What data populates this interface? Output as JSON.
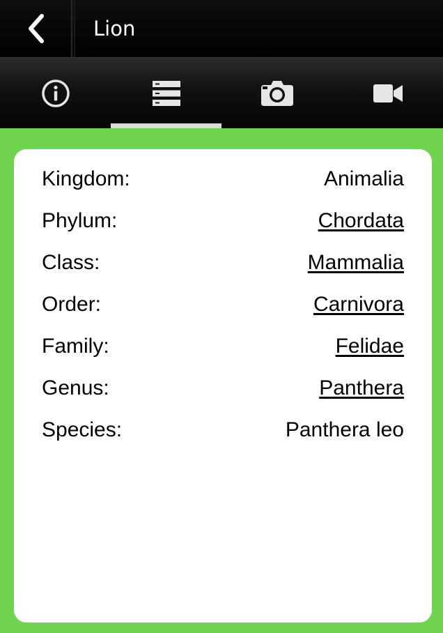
{
  "header": {
    "title": "Lion",
    "back_icon": "chevron-left-icon"
  },
  "tabs": [
    {
      "icon": "info-icon",
      "active": false
    },
    {
      "icon": "list-icon",
      "active": true
    },
    {
      "icon": "camera-icon",
      "active": false
    },
    {
      "icon": "video-icon",
      "active": false
    }
  ],
  "taxonomy": [
    {
      "label": "Kingdom:",
      "value": "Animalia",
      "link": false
    },
    {
      "label": "Phylum:",
      "value": "Chordata",
      "link": true
    },
    {
      "label": "Class:",
      "value": "Mammalia",
      "link": true
    },
    {
      "label": "Order:",
      "value": "Carnivora",
      "link": true
    },
    {
      "label": "Family:",
      "value": "Felidae",
      "link": true
    },
    {
      "label": "Genus:",
      "value": "Panthera",
      "link": true
    },
    {
      "label": "Species:",
      "value": "Panthera leo",
      "link": false
    }
  ],
  "colors": {
    "background": "#6fd34f",
    "header": "#000000",
    "card": "#ffffff",
    "active_tab_indicator": "#d9d9d9"
  }
}
